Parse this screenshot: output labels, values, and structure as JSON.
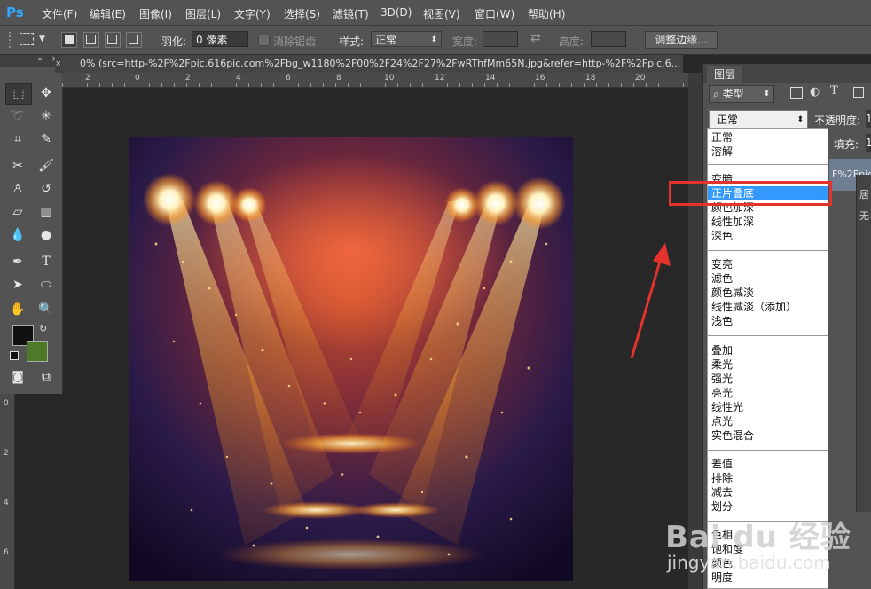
{
  "app": {
    "logo": "Ps"
  },
  "menubar": {
    "items": [
      "文件(F)",
      "编辑(E)",
      "图像(I)",
      "图层(L)",
      "文字(Y)",
      "选择(S)",
      "滤镜(T)",
      "3D(D)",
      "视图(V)",
      "窗口(W)",
      "帮助(H)"
    ]
  },
  "options": {
    "feather_label": "羽化:",
    "feather_value": "0 像素",
    "antialias_label": "消除锯齿",
    "style_label": "样式:",
    "style_value": "正常",
    "width_label": "宽度:",
    "height_label": "高度:",
    "refine_edge_label": "调整边缘..."
  },
  "document": {
    "tab_title": "0% (src=http-%2F%2Fpic.616pic.com%2Fbg_w1180%2F00%2F24%2F27%2FwRThfMm65N.jpg&refer=http-%2F%2Fpic.6..."
  },
  "ruler": {
    "top_labels": [
      "2",
      "0",
      "2",
      "4",
      "6",
      "8",
      "10",
      "12",
      "14",
      "16",
      "18",
      "20"
    ],
    "left_labels": [
      "0",
      "2",
      "4",
      "6"
    ]
  },
  "colors": {
    "foreground": "#111111",
    "background": "#4e7a28",
    "highlight": "#3399ff",
    "annotation": "#e5322d",
    "ui_panel": "#535353"
  },
  "layers_panel": {
    "tab_label": "图层",
    "filter_label": "类型",
    "blend_mode_value": "正常",
    "opacity_label": "不透明度:",
    "opacity_value": "1",
    "fill_label": "填充:",
    "fill_value": "1",
    "layer_name_partial": "F%2Fpic",
    "side_labels": [
      "居",
      "无"
    ]
  },
  "blend_modes": {
    "groups": [
      [
        "正常",
        "溶解"
      ],
      [
        "变暗",
        "正片叠底",
        "颜色加深",
        "线性加深",
        "深色"
      ],
      [
        "变亮",
        "滤色",
        "颜色减淡",
        "线性减淡（添加）",
        "浅色"
      ],
      [
        "叠加",
        "柔光",
        "强光",
        "亮光",
        "线性光",
        "点光",
        "实色混合"
      ],
      [
        "差值",
        "排除",
        "减去",
        "划分"
      ],
      [
        "色相",
        "饱和度",
        "颜色",
        "明度"
      ]
    ],
    "selected": "正片叠底"
  },
  "watermark": {
    "brand": "Bai du 经验",
    "site": "jingyan.baidu.com"
  }
}
